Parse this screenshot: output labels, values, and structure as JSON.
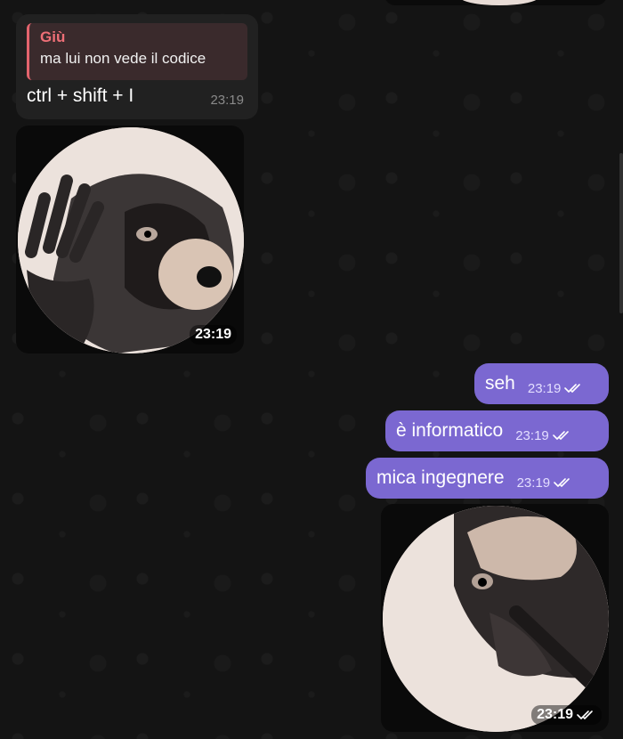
{
  "chat": {
    "incoming": {
      "reply": {
        "author": "Giù",
        "text": "ma lui non vede il codice"
      },
      "text": "ctrl + shift + I",
      "time": "23:19"
    },
    "incoming_video": {
      "time": "23:19"
    },
    "outgoing": [
      {
        "text": "seh",
        "time": "23:19"
      },
      {
        "text": "è informatico",
        "time": "23:19"
      },
      {
        "text": "mica ingegnere",
        "time": "23:19"
      }
    ],
    "outgoing_video": {
      "time": "23:19"
    }
  },
  "colors": {
    "outgoing_bubble": "#7b68d1",
    "incoming_bubble": "#212121",
    "reply_accent": "#e3646d",
    "background": "#121212"
  },
  "icons": {
    "read_status": "double-check-icon"
  }
}
